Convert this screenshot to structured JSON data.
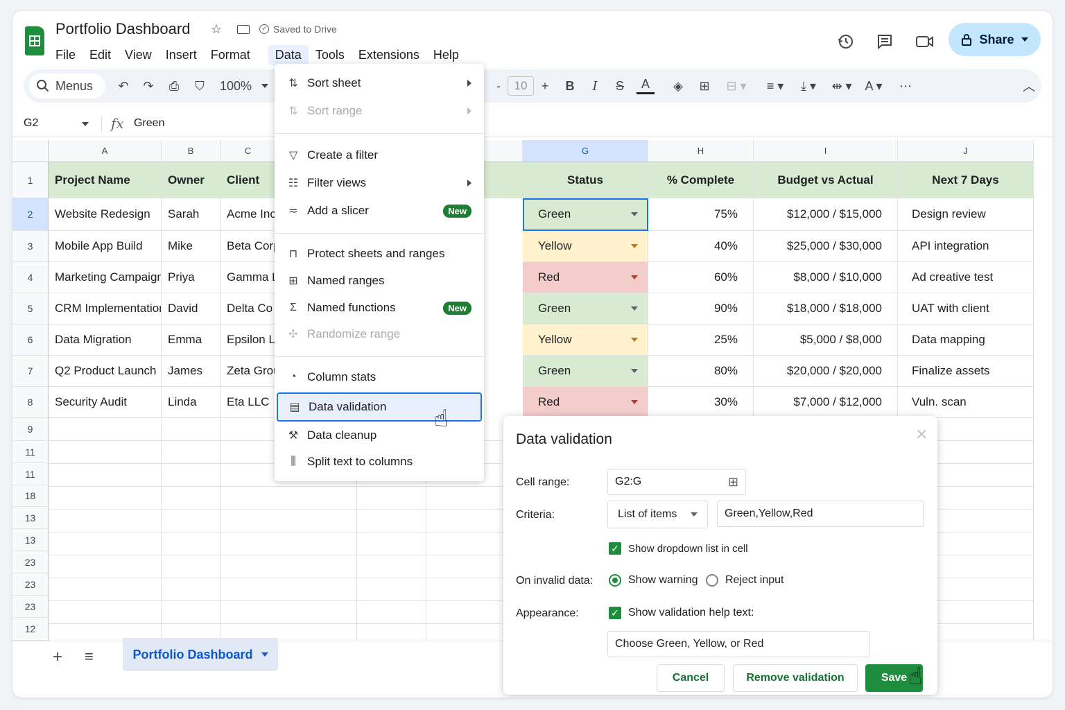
{
  "header": {
    "title": "Portfolio Dashboard",
    "saved_status": "Saved to Drive",
    "share_label": "Share"
  },
  "menubar": [
    "File",
    "Edit",
    "View",
    "Insert",
    "Format",
    "Data",
    "Tools",
    "Extensions",
    "Help"
  ],
  "toolbar": {
    "search_label": "Menus",
    "zoom": "100%",
    "font_size": "10"
  },
  "formula_bar": {
    "cell_ref": "G2",
    "value": "Green"
  },
  "columns": [
    "A",
    "B",
    "C",
    "G",
    "H",
    "I",
    "J"
  ],
  "row_numbers": [
    "1",
    "2",
    "3",
    "4",
    "5",
    "6",
    "7",
    "8",
    "9",
    "11",
    "11",
    "18",
    "13",
    "13",
    "23",
    "23",
    "23",
    "12"
  ],
  "table": {
    "headers": {
      "project": "Project Name",
      "owner": "Owner",
      "client": "Client",
      "status": "Status",
      "complete": "% Complete",
      "budget": "Budget vs Actual",
      "next": "Next 7 Days"
    },
    "rows": [
      {
        "project": "Website Redesign",
        "owner": "Sarah",
        "client": "Acme Inc.",
        "status": "Green",
        "complete": "75%",
        "budget": "$12,000 / $15,000",
        "next": "Design review"
      },
      {
        "project": "Mobile App Build",
        "owner": "Mike",
        "client": "Beta Corp",
        "status": "Yellow",
        "complete": "40%",
        "budget": "$25,000 / $30,000",
        "next": "API integration"
      },
      {
        "project": "Marketing Campaign",
        "owner": "Priya",
        "client": "Gamma Lt",
        "status": "Red",
        "complete": "60%",
        "budget": "$8,000 / $10,000",
        "next": "Ad creative test"
      },
      {
        "project": "CRM Implementation",
        "owner": "David",
        "client": "Delta Co",
        "status": "Green",
        "complete": "90%",
        "budget": "$18,000 / $18,000",
        "next": "UAT with client"
      },
      {
        "project": "Data Migration",
        "owner": "Emma",
        "client": "Epsilon Lt",
        "status": "Yellow",
        "complete": "25%",
        "budget": "$5,000 / $8,000",
        "next": "Data mapping"
      },
      {
        "project": "Q2 Product Launch",
        "owner": "James",
        "client": "Zeta Grou",
        "status": "Green",
        "complete": "80%",
        "budget": "$20,000 / $20,000",
        "next": "Finalize assets"
      },
      {
        "project": "Security Audit",
        "owner": "Linda",
        "client": "Eta LLC",
        "status": "Red",
        "complete": "30%",
        "budget": "$7,000 / $12,000",
        "next": "Vuln. scan"
      }
    ]
  },
  "data_menu": {
    "sort_sheet": "Sort sheet",
    "sort_range": "Sort range",
    "create_filter": "Create a filter",
    "filter_views": "Filter views",
    "add_slicer": "Add a slicer",
    "protect": "Protect sheets and ranges",
    "named_ranges": "Named ranges",
    "named_functions": "Named functions",
    "randomize": "Randomize range",
    "column_stats": "Column stats",
    "data_validation": "Data validation",
    "data_cleanup": "Data cleanup",
    "split_text": "Split text to columns",
    "new_badge": "New"
  },
  "dialog": {
    "title": "Data validation",
    "cell_range_label": "Cell range:",
    "cell_range_value": "G2:G",
    "criteria_label": "Criteria:",
    "criteria_type": "List of items",
    "criteria_items": "Green,Yellow,Red",
    "show_dropdown": "Show dropdown list in cell",
    "invalid_label": "On invalid data:",
    "show_warning": "Show warning",
    "reject_input": "Reject input",
    "appearance_label": "Appearance:",
    "show_help": "Show validation help text:",
    "help_text": "Choose Green, Yellow, or Red",
    "cancel": "Cancel",
    "remove": "Remove validation",
    "save": "Save"
  },
  "sheet_tab": "Portfolio Dashboard",
  "colors": {
    "accent": "#1a73e8",
    "header_green": "#d9ead3",
    "status_green": "#d9ead3",
    "status_yellow": "#fff2cc",
    "status_red": "#f4cccc",
    "brand_green": "#1e8e3e"
  }
}
